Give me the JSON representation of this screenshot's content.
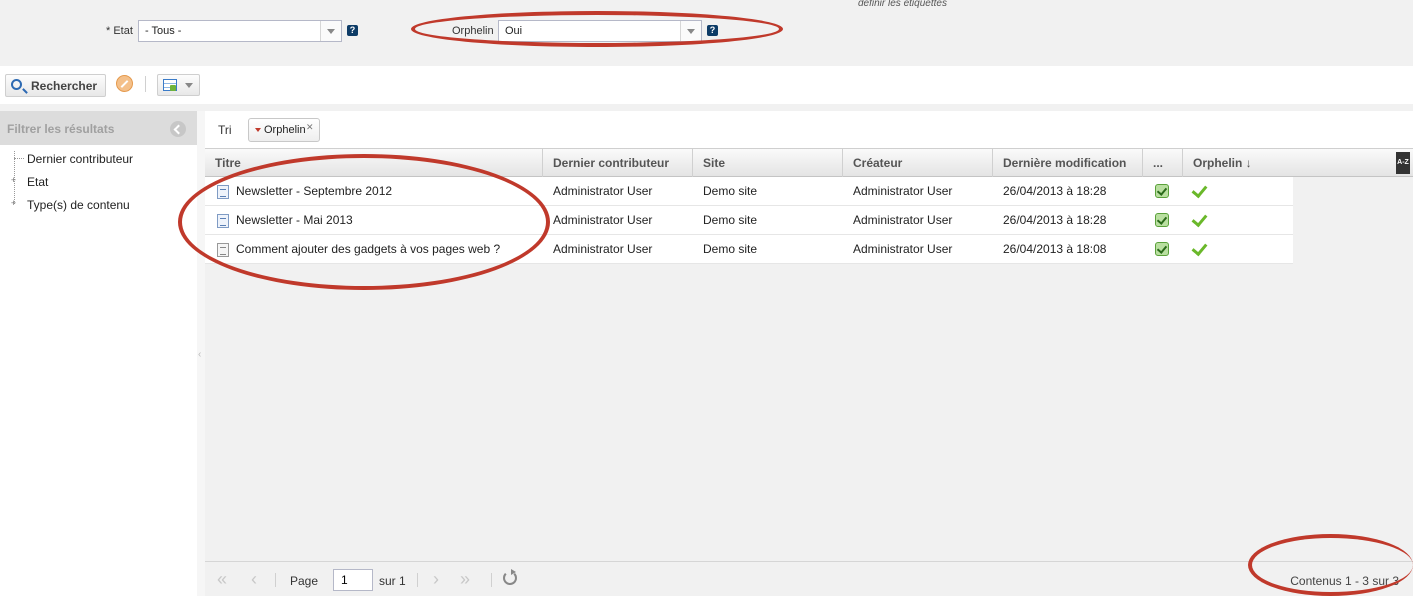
{
  "top_form": {
    "hint_text": "définir les étiquettes",
    "etat": {
      "label": "* Etat",
      "value": "- Tous -"
    },
    "orphelin": {
      "label": "Orphelin",
      "value": "Oui"
    },
    "help_glyph": "?"
  },
  "toolbar": {
    "search_label": "Rechercher"
  },
  "filter_panel": {
    "title": "Filtrer les résultats",
    "items": [
      {
        "label": "Dernier contributeur",
        "expandable": false
      },
      {
        "label": "Etat",
        "expandable": true
      },
      {
        "label": "Type(s) de contenu",
        "expandable": true
      }
    ]
  },
  "sort_bar": {
    "label": "Tri",
    "chip_label": "Orphelin"
  },
  "grid": {
    "columns": [
      "Titre",
      "Dernier contributeur",
      "Site",
      "Créateur",
      "Dernière modification",
      "...",
      "Orphelin ↓"
    ],
    "sort_icon_text": "A-Z",
    "rows": [
      {
        "icon": "newsletter-icon",
        "title": "Newsletter - Septembre 2012",
        "contributor": "Administrator User",
        "site": "Demo site",
        "creator": "Administrator User",
        "modified": "26/04/2013 à 18:28"
      },
      {
        "icon": "newsletter-icon",
        "title": "Newsletter - Mai 2013",
        "contributor": "Administrator User",
        "site": "Demo site",
        "creator": "Administrator User",
        "modified": "26/04/2013 à 18:28"
      },
      {
        "icon": "article-icon",
        "title": "Comment ajouter des gadgets à vos pages web ?",
        "contributor": "Administrator User",
        "site": "Demo site",
        "creator": "Administrator User",
        "modified": "26/04/2013 à 18:08"
      }
    ]
  },
  "pager": {
    "first": "«",
    "prev": "‹",
    "page_label": "Page",
    "page_value": "1",
    "of_label": "sur 1",
    "next": "›",
    "last": "»",
    "info": "Contenus 1 - 3 sur 3"
  },
  "colors": {
    "annotation_red": "#c0392b",
    "check_green": "#6ab82a"
  }
}
